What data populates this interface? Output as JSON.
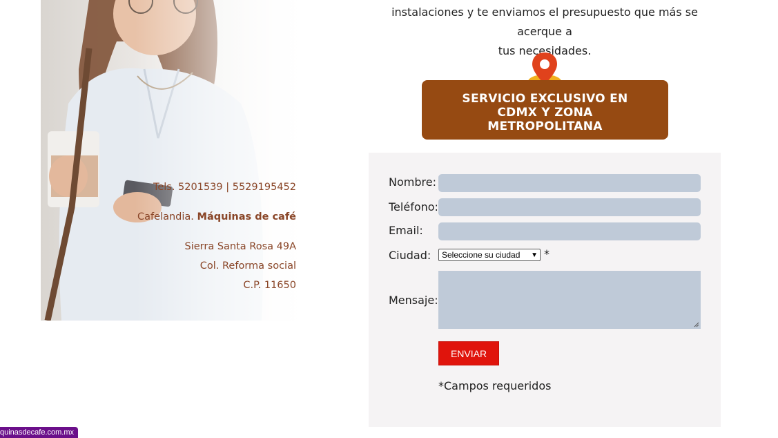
{
  "left_panel": {
    "phone_line": "Tels. 5201539 | 5529195452",
    "brand_regular": "Cafelandia. ",
    "brand_bold": "Máquinas de café",
    "address_line1": "Sierra Santa Rosa 49A",
    "address_line2": "Col. Reforma social",
    "address_line3": "C.P. 11650"
  },
  "intro": {
    "line1": "instalaciones y te enviamos el presupuesto que más se acerque a",
    "line2": "tus necesidades."
  },
  "banner": {
    "line1": "SERVICIO EXCLUSIVO EN",
    "line2": "CDMX Y ZONA",
    "line3": "METROPOLITANA",
    "color": "#964a12",
    "pin_color": "#e0421c"
  },
  "form": {
    "name_label": "Nombre:",
    "phone_label": "Teléfono:",
    "email_label": "Email:",
    "city_label": "Ciudad:",
    "city_selected": "Seleccione su ciudad",
    "required_mark": "*",
    "message_label": "Mensaje:",
    "send_label": "ENVIAR",
    "required_note": "*Campos requeridos",
    "field_color": "#bfcad8",
    "button_color": "#e0140c"
  },
  "status_bar": {
    "url": "quinasdecafe.com.mx"
  }
}
